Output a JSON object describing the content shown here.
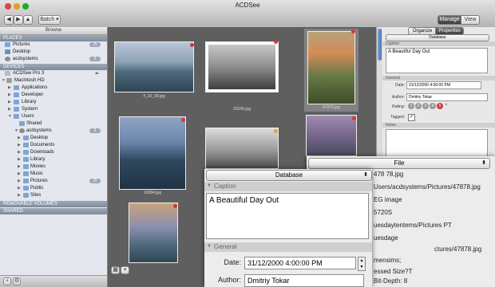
{
  "window": {
    "title": "ACDSee",
    "batch_label": "Batch",
    "modes": [
      "Manage",
      "View"
    ]
  },
  "sidebar": {
    "header": "Browse",
    "sections": {
      "places": "PLACES",
      "devices": "DEVICES",
      "removable": "REMOVABLE VOLUMES",
      "shared": "SHARED"
    },
    "places": [
      {
        "label": "Pictures",
        "badge": "25"
      },
      {
        "label": "Desktop",
        "badge": ""
      },
      {
        "label": "acdsystems",
        "badge": "9"
      }
    ],
    "devices": [
      {
        "label": "ACDSee Pro 3",
        "badge": ""
      },
      {
        "label": "Macintosh HD",
        "badge": ""
      },
      {
        "label": "Applications",
        "badge": ""
      },
      {
        "label": "Developer",
        "badge": ""
      },
      {
        "label": "Library",
        "badge": ""
      },
      {
        "label": "System",
        "badge": ""
      },
      {
        "label": "Users",
        "badge": ""
      },
      {
        "label": "Shared",
        "badge": ""
      },
      {
        "label": "acdsystems",
        "badge": "9"
      },
      {
        "label": "Desktop",
        "badge": ""
      },
      {
        "label": "Documents",
        "badge": ""
      },
      {
        "label": "Downloads",
        "badge": ""
      },
      {
        "label": "Library",
        "badge": ""
      },
      {
        "label": "Movies",
        "badge": ""
      },
      {
        "label": "Music",
        "badge": ""
      },
      {
        "label": "Pictures",
        "badge": "25"
      },
      {
        "label": "Public",
        "badge": ""
      },
      {
        "label": "Sites",
        "badge": ""
      }
    ]
  },
  "thumbnails": [
    {
      "name": "4_20_30.jpg"
    },
    {
      "name": "20245.jpg"
    },
    {
      "name": "47878.jpg"
    },
    {
      "name": "16584.jpg"
    },
    {
      "name": "",
      "note": ""
    },
    {
      "name": ""
    },
    {
      "name": ""
    }
  ],
  "right_panel": {
    "tabs": [
      "Organize",
      "Properties"
    ],
    "selector": "Database",
    "caption_header": "Caption",
    "caption_value": "A Beautiful Day Out",
    "general_header": "General",
    "date_label": "Date:",
    "date_value": "31/12/2000   4:00:00 PM",
    "author_label": "Author:",
    "author_value": "Dmitriy Tokar",
    "rating_label": "Rating:",
    "rating_values": [
      "1",
      "2",
      "3",
      "4",
      "5"
    ],
    "tagged_label": "Tagged:",
    "notes_header": "Notes"
  },
  "zoom_database": {
    "selector": "Database",
    "caption_header": "Caption",
    "caption_value": "A Beautiful Day Out",
    "general_header": "General",
    "date_label": "Date:",
    "date_value": "31/12/2000   4:00:00 PM",
    "author_label": "Author:",
    "author_value": "Dmitriy Tokar"
  },
  "zoom_file": {
    "selector": "File",
    "lines": [
      "478 78.jpg",
      "Users/acdsystems/Pictures/47878.jpg",
      "EG image",
      "5720S",
      "uesdaytentems/Pictures PT",
      "uesdage",
      "ctures/47878.jpg",
      "mensims;",
      "essed Size?T",
      "Bit-Depth:   8"
    ]
  }
}
